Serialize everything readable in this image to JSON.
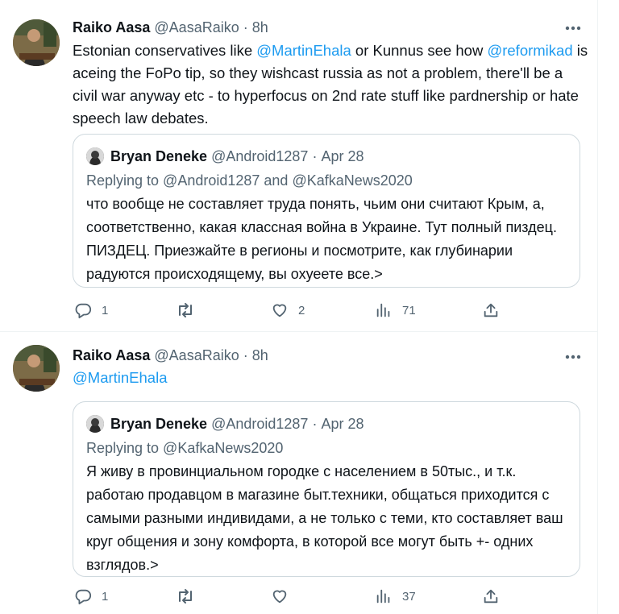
{
  "tweets": [
    {
      "author_name": "Raiko Aasa",
      "author_handle": "@AasaRaiko",
      "separator": "·",
      "time": "8h",
      "text_segments": [
        {
          "t": "Estonian conservatives like ",
          "mention": false
        },
        {
          "t": "@MartinEhala",
          "mention": true
        },
        {
          "t": " or Kunnus see how ",
          "mention": false
        },
        {
          "t": "@reformikad",
          "mention": true
        },
        {
          "t": " is aceing the FoPo tip, so they wishcast russia as not a problem, there'll be a civil war anyway etc - to hyperfocus on 2nd rate stuff like pardnership or hate speech law debates.",
          "mention": false
        }
      ],
      "quote": {
        "author_name": "Bryan Deneke",
        "author_handle": "@Android1287",
        "separator": "·",
        "date": "Apr 28",
        "replying_to": "Replying to @Android1287 and @KafkaNews2020",
        "text": "что вообще не составляет труда понять, чьим они считают Крым, а, соответственно, какая классная война в Украине. Тут полный пиздец. ПИЗДЕЦ. Приезжайте в регионы и посмотрите, как глубинарии радуются происходящему, вы охуеете все.>"
      },
      "actions": {
        "replies": "1",
        "retweets": "",
        "likes": "2",
        "views": "71"
      }
    },
    {
      "author_name": "Raiko Aasa",
      "author_handle": "@AasaRaiko",
      "separator": "·",
      "time": "8h",
      "text_segments": [
        {
          "t": "@MartinEhala",
          "mention": true
        }
      ],
      "quote": {
        "author_name": "Bryan Deneke",
        "author_handle": "@Android1287",
        "separator": "·",
        "date": "Apr 28",
        "replying_to": "Replying to @KafkaNews2020",
        "text": "Я живу в провинциальном городке с населением в 50тыс., и т.к. работаю продавцом в магазине быт.техники, общаться приходится с самыми разными индивидами, а не только с теми, кто составляет ваш круг общения и зону комфорта, в которой все могут быть +- одних взглядов.>"
      },
      "actions": {
        "replies": "1",
        "retweets": "",
        "likes": "",
        "views": "37"
      }
    }
  ],
  "colors": {
    "mention": "#1d9bf0",
    "secondary_text": "#536471",
    "primary_text": "#0f1419",
    "border": "#cfd9de"
  },
  "icons": [
    "more-icon",
    "reply-icon",
    "retweet-icon",
    "like-icon",
    "views-icon",
    "share-icon"
  ]
}
